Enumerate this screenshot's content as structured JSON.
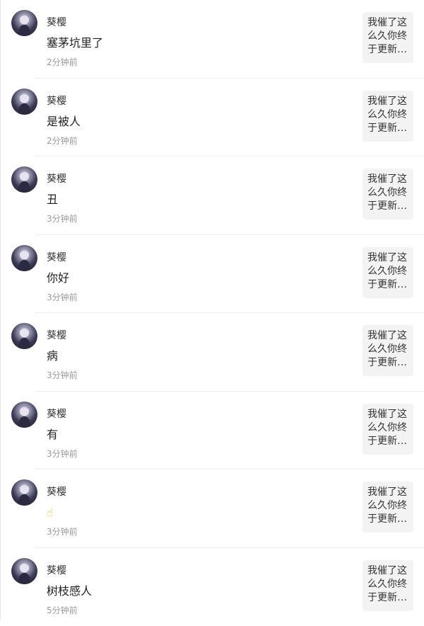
{
  "comments": [
    {
      "user": "葵樱",
      "content": "塞茅坑里了",
      "time": "2分钟前",
      "quote": "我催了这么久你终于更新…"
    },
    {
      "user": "葵樱",
      "content": "是被人",
      "time": "2分钟前",
      "quote": "我催了这么久你终于更新…"
    },
    {
      "user": "葵樱",
      "content": "丑",
      "time": "3分钟前",
      "quote": "我催了这么久你终于更新…"
    },
    {
      "user": "葵樱",
      "content": "你好",
      "time": "3分钟前",
      "quote": "我催了这么久你终于更新…"
    },
    {
      "user": "葵樱",
      "content": "病",
      "time": "3分钟前",
      "quote": "我催了这么久你终于更新…"
    },
    {
      "user": "葵樱",
      "content": "有",
      "time": "3分钟前",
      "quote": "我催了这么久你终于更新…"
    },
    {
      "user": "葵樱",
      "content": "☝",
      "time": "3分钟前",
      "quote": "我催了这么久你终于更新…"
    },
    {
      "user": "葵樱",
      "content": "树枝感人",
      "time": "5分钟前",
      "quote": "我催了这么久你终于更新…"
    }
  ]
}
